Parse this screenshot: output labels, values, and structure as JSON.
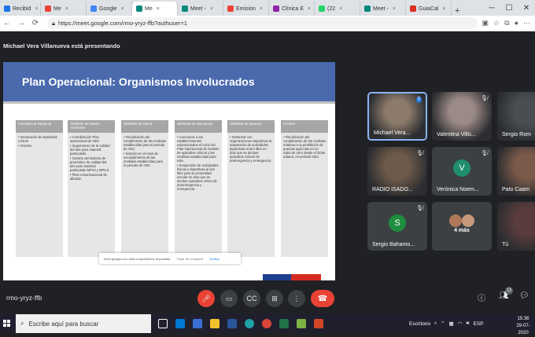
{
  "browser": {
    "tabs": [
      {
        "label": "Recibid",
        "color": "#1a73e8"
      },
      {
        "label": "Me",
        "color": "#ea4335"
      },
      {
        "label": "Google",
        "color": "#4285f4"
      },
      {
        "label": "Me",
        "color": "#00897b"
      },
      {
        "label": "Meet -",
        "color": "#00897b"
      },
      {
        "label": "Emision",
        "color": "#ea4335"
      },
      {
        "label": "Clínica E",
        "color": "#8e24aa"
      },
      {
        "label": "(22",
        "color": "#25d366"
      },
      {
        "label": "Meet -",
        "color": "#00897b"
      },
      {
        "label": "GuiaCal",
        "color": "#d93025"
      }
    ],
    "new_tab": "+",
    "url": "https://meet.google.com/rmo-yryz-ffb?authuser=1"
  },
  "meet": {
    "presenter_text": "Michael Vera Villanueva está presentando",
    "meeting_code": "rmo-yryz-ffb",
    "participant_count": "13",
    "participants": [
      {
        "name": "Michael Vera...",
        "muted": false,
        "kind": "photo",
        "color": "#8c7b6b"
      },
      {
        "name": "Valentina Villo...",
        "muted": true,
        "kind": "photo",
        "color": "#9b8a86"
      },
      {
        "name": "Sergio Rom",
        "muted": false,
        "kind": "photo",
        "color": "#4a4e52"
      },
      {
        "name": "RADIO ISADO...",
        "muted": true,
        "kind": "photo",
        "color": "#6d5a4a"
      },
      {
        "name": "Verónica Noem...",
        "muted": true,
        "kind": "avatar",
        "letter": "V",
        "color": "#1e8e6e"
      },
      {
        "name": "Pato Caam",
        "muted": true,
        "kind": "photo",
        "color": "#7a5a4a"
      },
      {
        "name": "Sergio Bahamo...",
        "muted": true,
        "kind": "avatar",
        "letter": "S",
        "color": "#1e8e3e"
      },
      {
        "name": "4 más",
        "muted": false,
        "kind": "more",
        "color": "#3c4043"
      },
      {
        "name": "Tú",
        "muted": false,
        "kind": "photo",
        "color": "#5a3c3c"
      }
    ]
  },
  "slide": {
    "title": "Plan Operacional: Organismos Involucrados",
    "columns": [
      {
        "header": "Intendencia Regional",
        "items": [
          "Declaración de Episodios críticos",
          "Vocería"
        ]
      },
      {
        "header": "SEREMI del Medio Ambiente",
        "items": [
          "Coordinación Plan operacional de GEC",
          "Seguimiento de la calidad del aire para material particulado",
          "Gestión del sistema de pronóstico de calidad del aire para material particulado MP10 y MP2,5",
          "Plan comunicacional de difusión"
        ]
      },
      {
        "header": "SEREMI de Salud",
        "items": [
          "Fiscalización del cumplimiento de las medidas establecidas para el periodo de GEC",
          "Sanción en el caso de incumplimiento de las medidas establecidas para el periodo de GEC"
        ]
      },
      {
        "header": "SEREMI de Educación",
        "items": [
          "Comunicar a los establecimientos educacionales el inicio del Plan Operacional de Gestión de episodios críticos y las medidas establecidas para este.",
          "Suspensión de actividades físicas y deportivas al aire libre para la comunidad escolar en días que se declare episodios crítico de preemergencia y emergencia."
        ]
      },
      {
        "header": "SEREMI de Deporte",
        "items": [
          "Gestionar con organizaciones deportivas la suspensión de actividades deportivas al aire libre en días que se declare episodios críticos de premergencia y emergencia."
        ]
      },
      {
        "header": "CONAF",
        "items": [
          "Fiscalización del cumplimiento de las medidas relativas a la prohibición de quemas agrícolas en un radio de 1Km desde el límite urbano, en periodo GEC."
        ]
      }
    ],
    "toast": {
      "text": "meet.google.com está compartiendo la pantalla.",
      "stop": "Dejar de compartir",
      "hide": "Ocultar"
    }
  },
  "taskbar": {
    "search_placeholder": "Escribe aquí para buscar",
    "desktop_label": "Escritorio",
    "lang": "ESP",
    "time": "15:36",
    "date": "29-07-2020"
  }
}
